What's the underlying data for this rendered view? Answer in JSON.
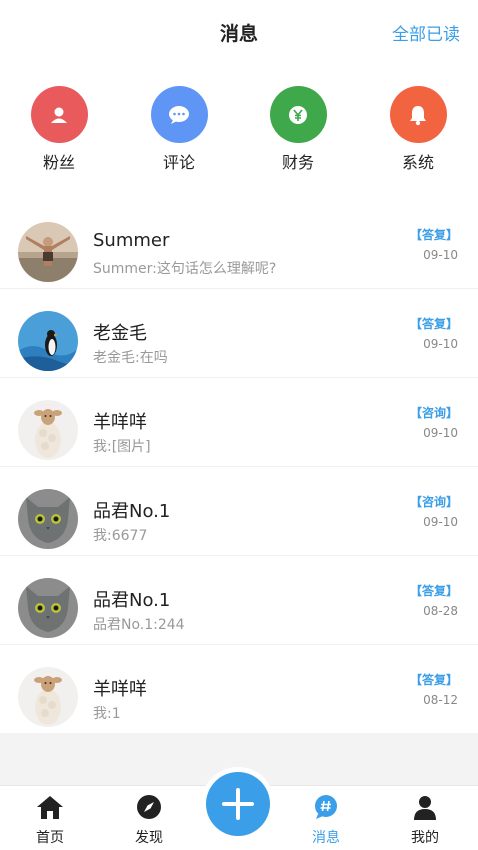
{
  "header": {
    "title": "消息",
    "mark_all": "全部已读"
  },
  "categories": [
    {
      "label": "粉丝",
      "color": "#e95a5d",
      "icon": "user-icon"
    },
    {
      "label": "评论",
      "color": "#5f96f5",
      "icon": "comment-icon"
    },
    {
      "label": "财务",
      "color": "#3ea84a",
      "icon": "yen-icon"
    },
    {
      "label": "系统",
      "color": "#f2643f",
      "icon": "bell-icon"
    }
  ],
  "messages": [
    {
      "name": "Summer",
      "preview": "Summer:这句话怎么理解呢?",
      "tag": "【答复】",
      "date": "09-10"
    },
    {
      "name": "老金毛",
      "preview": "老金毛:在吗",
      "tag": "【答复】",
      "date": "09-10"
    },
    {
      "name": "羊咩咩",
      "preview": "我:[图片]",
      "tag": "【咨询】",
      "date": "09-10"
    },
    {
      "name": "品君No.1",
      "preview": "我:6677",
      "tag": "【咨询】",
      "date": "09-10"
    },
    {
      "name": "品君No.1",
      "preview": "品君No.1:244",
      "tag": "【答复】",
      "date": "08-28"
    },
    {
      "name": "羊咩咩",
      "preview": "我:1",
      "tag": "【答复】",
      "date": "08-12"
    }
  ],
  "tabbar": {
    "home": "首页",
    "discover": "发现",
    "messages": "消息",
    "mine": "我的"
  },
  "colors": {
    "accent": "#3a9ee8"
  }
}
